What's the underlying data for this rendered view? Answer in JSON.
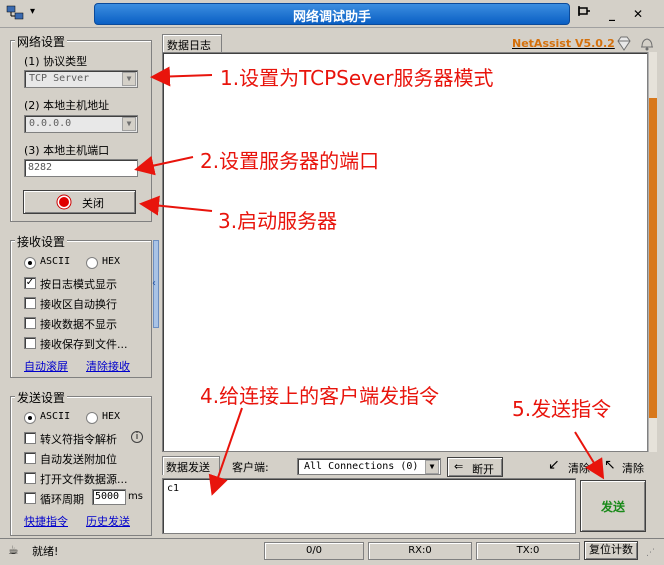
{
  "window": {
    "title": "网络调试助手",
    "app_icon": "network-icon",
    "menu_arrow": "▾",
    "pin_glyph": "📌",
    "minimize_glyph": "_",
    "close_glyph": "✕"
  },
  "brand": {
    "name": "NetAssist V5.0.2",
    "color": "#d4700c"
  },
  "network_settings": {
    "title": "网络设置",
    "protocol_label": "(1) 协议类型",
    "protocol_value": "TCP Server",
    "host_label": "(2) 本地主机地址",
    "host_value": "0.0.0.0",
    "port_label": "(3) 本地主机端口",
    "port_value": "8282",
    "toggle_label": "关闭"
  },
  "receive_settings": {
    "title": "接收设置",
    "ascii": "ASCII",
    "hex": "HEX",
    "options": [
      "按日志模式显示",
      "接收区自动换行",
      "接收数据不显示",
      "接收保存到文件..."
    ],
    "options_checked": [
      true,
      false,
      false,
      false
    ],
    "auto_scroll": "自动滚屏",
    "clear_receive": "清除接收"
  },
  "send_settings": {
    "title": "发送设置",
    "ascii": "ASCII",
    "hex": "HEX",
    "options": [
      "转义符指令解析",
      "自动发送附加位",
      "打开文件数据源...",
      "循环周期"
    ],
    "cycle_value": "5000",
    "cycle_unit": "ms",
    "shortcut_cmd": "快捷指令",
    "history": "历史发送"
  },
  "log": {
    "tab_label": "数据日志"
  },
  "send_bar": {
    "tab_label": "数据发送",
    "client_label": "客户端:",
    "client_value": "All Connections (0)",
    "disconnect_label": "断开",
    "clear1": "清除",
    "clear2": "清除",
    "send_text": "c1",
    "send_button": "发送"
  },
  "status_bar": {
    "status": "就绪!",
    "count": "0/0",
    "rx": "RX:0",
    "tx": "TX:0",
    "reset": "复位计数"
  },
  "annotations": {
    "a1": "1.设置为TCPSever服务器模式",
    "a2": "2.设置服务器的端口",
    "a3": "3.启动服务器",
    "a4": "4.给连接上的客户端发指令",
    "a5": "5.发送指令",
    "color": "#e8140c"
  }
}
